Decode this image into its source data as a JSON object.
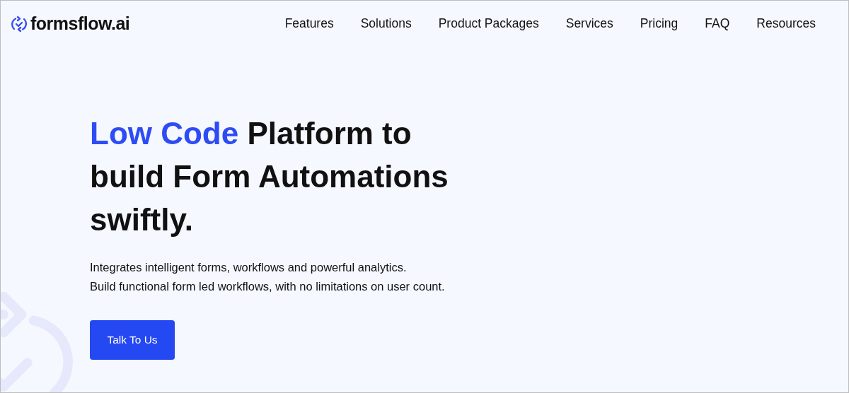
{
  "logo": {
    "text": "formsflow.ai"
  },
  "nav": [
    "Features",
    "Solutions",
    "Product Packages",
    "Services",
    "Pricing",
    "FAQ",
    "Resources"
  ],
  "hero": {
    "headline_highlight": "Low Code",
    "headline_rest": "Platform to build Form Automations swiftly.",
    "description": [
      "Integrates intelligent forms, workflows and powerful analytics.",
      "Build functional form led workflows, with no limitations on user count."
    ],
    "button": "Talk To Us"
  }
}
